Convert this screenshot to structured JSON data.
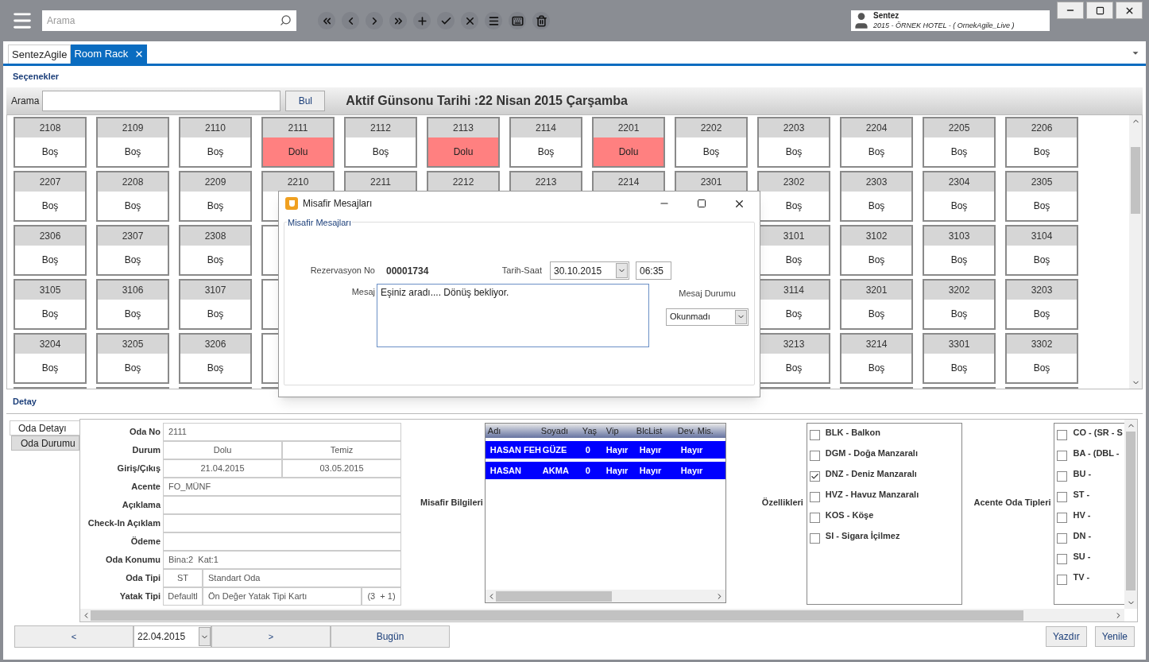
{
  "search": {
    "placeholder": "Arama"
  },
  "user": {
    "name": "Sentez",
    "context": "2015 - ÖRNEK HOTEL - ( OrnekAgile_Live )"
  },
  "tabs": [
    {
      "label": "SentezAgile",
      "selected": false,
      "closable": false
    },
    {
      "label": "Room Rack",
      "selected": true,
      "closable": true
    }
  ],
  "options_title": "Seçenekler",
  "search_bar": {
    "label": "Arama",
    "button": "Bul",
    "active_date": "Aktif Günsonu Tarihi :22 Nisan 2015 Çarşamba"
  },
  "rooms": [
    [
      {
        "number": "2108",
        "status": "Boş",
        "occupied": false
      },
      {
        "number": "2109",
        "status": "Boş",
        "occupied": false
      },
      {
        "number": "2110",
        "status": "Boş",
        "occupied": false
      },
      {
        "number": "2111",
        "status": "Dolu",
        "occupied": true
      },
      {
        "number": "2112",
        "status": "Boş",
        "occupied": false
      },
      {
        "number": "2113",
        "status": "Dolu",
        "occupied": true
      },
      {
        "number": "2114",
        "status": "Boş",
        "occupied": false
      },
      {
        "number": "2201",
        "status": "Dolu",
        "occupied": true
      },
      {
        "number": "2202",
        "status": "Boş",
        "occupied": false
      },
      {
        "number": "2203",
        "status": "Boş",
        "occupied": false
      },
      {
        "number": "2204",
        "status": "Boş",
        "occupied": false
      },
      {
        "number": "2205",
        "status": "Boş",
        "occupied": false
      },
      {
        "number": "2206",
        "status": "Boş",
        "occupied": false
      }
    ],
    [
      {
        "number": "2207",
        "status": "Boş",
        "occupied": false
      },
      {
        "number": "2208",
        "status": "Boş",
        "occupied": false
      },
      {
        "number": "2209",
        "status": "Boş",
        "occupied": false
      },
      {
        "number": "2210"
      },
      {
        "number": "2211"
      },
      {
        "number": "2212"
      },
      {
        "number": "2213"
      },
      {
        "number": "2214"
      },
      {
        "number": "2301"
      },
      {
        "number": "2302",
        "status": "Boş",
        "occupied": false
      },
      {
        "number": "2303",
        "status": "Boş",
        "occupied": false
      },
      {
        "number": "2304",
        "status": "Boş",
        "occupied": false
      },
      {
        "number": "2305",
        "status": "Boş",
        "occupied": false
      }
    ],
    {
      "before": [
        {
          "number": "2306",
          "status": "Boş",
          "occupied": false
        },
        {
          "number": "2307",
          "status": "Boş",
          "occupied": false
        },
        {
          "number": "2308",
          "status": "Boş",
          "occupied": false
        }
      ],
      "after": [
        {
          "number": "3101",
          "status": "Boş",
          "occupied": false
        },
        {
          "number": "3102",
          "status": "Boş",
          "occupied": false
        },
        {
          "number": "3103",
          "status": "Boş",
          "occupied": false
        },
        {
          "number": "3104",
          "status": "Boş",
          "occupied": false
        }
      ]
    },
    {
      "before": [
        {
          "number": "3105",
          "status": "Boş",
          "occupied": false
        },
        {
          "number": "3106",
          "status": "Boş",
          "occupied": false
        },
        {
          "number": "3107",
          "status": "Boş",
          "occupied": false
        }
      ],
      "after": [
        {
          "number": "3114",
          "status": "Boş",
          "occupied": false
        },
        {
          "number": "3201",
          "status": "Boş",
          "occupied": false
        },
        {
          "number": "3202",
          "status": "Boş",
          "occupied": false
        },
        {
          "number": "3203",
          "status": "Boş",
          "occupied": false
        }
      ]
    },
    {
      "before": [
        {
          "number": "3204",
          "status": "Boş",
          "occupied": false
        },
        {
          "number": "3205",
          "status": "Boş",
          "occupied": false
        },
        {
          "number": "3206",
          "status": "Boş",
          "occupied": false
        }
      ],
      "after": [
        {
          "number": "3213",
          "status": "Boş",
          "occupied": false
        },
        {
          "number": "3214",
          "status": "Boş",
          "occupied": false
        },
        {
          "number": "3301",
          "status": "Boş",
          "occupied": false
        },
        {
          "number": "3302",
          "status": "Boş",
          "occupied": false
        }
      ]
    }
  ],
  "detail_title": "Detay",
  "detail_tabs": [
    {
      "label": "Oda Detayı",
      "selected": true
    },
    {
      "label": "Oda Durumu",
      "selected": false
    }
  ],
  "room_detail": [
    {
      "label": "Oda No",
      "kind": "single",
      "cells": [
        "2111"
      ]
    },
    {
      "label": "Durum",
      "kind": "split",
      "cells": [
        "Dolu",
        "Temiz"
      ]
    },
    {
      "label": "Giriş/Çıkış",
      "kind": "split",
      "cells": [
        "21.04.2015",
        "03.05.2015"
      ]
    },
    {
      "label": "Acente",
      "kind": "single",
      "cells": [
        "FO_MÜNF"
      ]
    },
    {
      "label": "Açıklama",
      "kind": "single"
    },
    {
      "label": "Check-In Açıklam",
      "kind": "single"
    },
    {
      "label": "Ödeme",
      "kind": "single"
    },
    {
      "label": "Oda Konumu",
      "kind": "single",
      "cells": [
        "Bina:2  Kat:1"
      ]
    },
    {
      "label": "Oda Tipi",
      "kind": "type",
      "cells": [
        "ST",
        "Standart Oda"
      ]
    },
    {
      "label": "Yatak Tipi",
      "kind": "type",
      "cells": [
        "Defaultl",
        "Ön Değer Yatak Tipi Kartı",
        "(3  + 1)"
      ]
    }
  ],
  "guests": {
    "label": "Misafir Bilgileri",
    "columns": [
      "Adı",
      "Soyadı",
      "Yaş",
      "Vip",
      "BlcList",
      "Dev. Mis."
    ],
    "rows": [
      {
        "cells": [
          "HASAN FEH",
          "GÜZE",
          "0",
          "Hayır",
          "Hayır",
          "Hayır"
        ],
        "selected": true
      },
      {
        "cells": [
          "HASAN",
          "AKMA",
          "0",
          "Hayır",
          "Hayır",
          "Hayır"
        ],
        "selected": true
      }
    ]
  },
  "features": {
    "label": "Özellikleri",
    "items": [
      {
        "label": "BLK - Balkon",
        "checked": false
      },
      {
        "label": "DGM - Doğa Manzaralı",
        "checked": false
      },
      {
        "label": "DNZ - Deniz Manzaralı",
        "checked": true
      },
      {
        "label": "HVZ - Havuz Manzaralı",
        "checked": false
      },
      {
        "label": "KOS - Köşe",
        "checked": false
      },
      {
        "label": "SI - Sigara İçilmez",
        "checked": false
      }
    ]
  },
  "agency_room_types": {
    "label": "Acente Oda Tipleri",
    "items": [
      {
        "label": "CO - (SR - S",
        "checked": false
      },
      {
        "label": "BA - (DBL -",
        "checked": false
      },
      {
        "label": "BU -",
        "checked": false
      },
      {
        "label": "ST -",
        "checked": false
      },
      {
        "label": "HV -",
        "checked": false
      },
      {
        "label": "DN -",
        "checked": false
      },
      {
        "label": "SU -",
        "checked": false
      },
      {
        "label": "TV -",
        "checked": false
      }
    ]
  },
  "date_nav": {
    "prev": "<",
    "date": "22.04.2015",
    "next": ">",
    "today": "Bugün"
  },
  "actions": [
    "Yazdır",
    "Yenile"
  ],
  "dialog": {
    "title": "Misafir Mesajları",
    "group_title": "Misafir Mesajları",
    "reservation_label": "Rezervasyon No",
    "reservation_no": "00001734",
    "datetime_label": "Tarih-Saat",
    "date": "30.10.2015",
    "time": "06:35",
    "message_label": "Mesaj",
    "message": "Eşiniz aradı.... Dönüş bekliyor.",
    "status_label": "Mesaj Durumu",
    "status": "Okunmadı"
  }
}
